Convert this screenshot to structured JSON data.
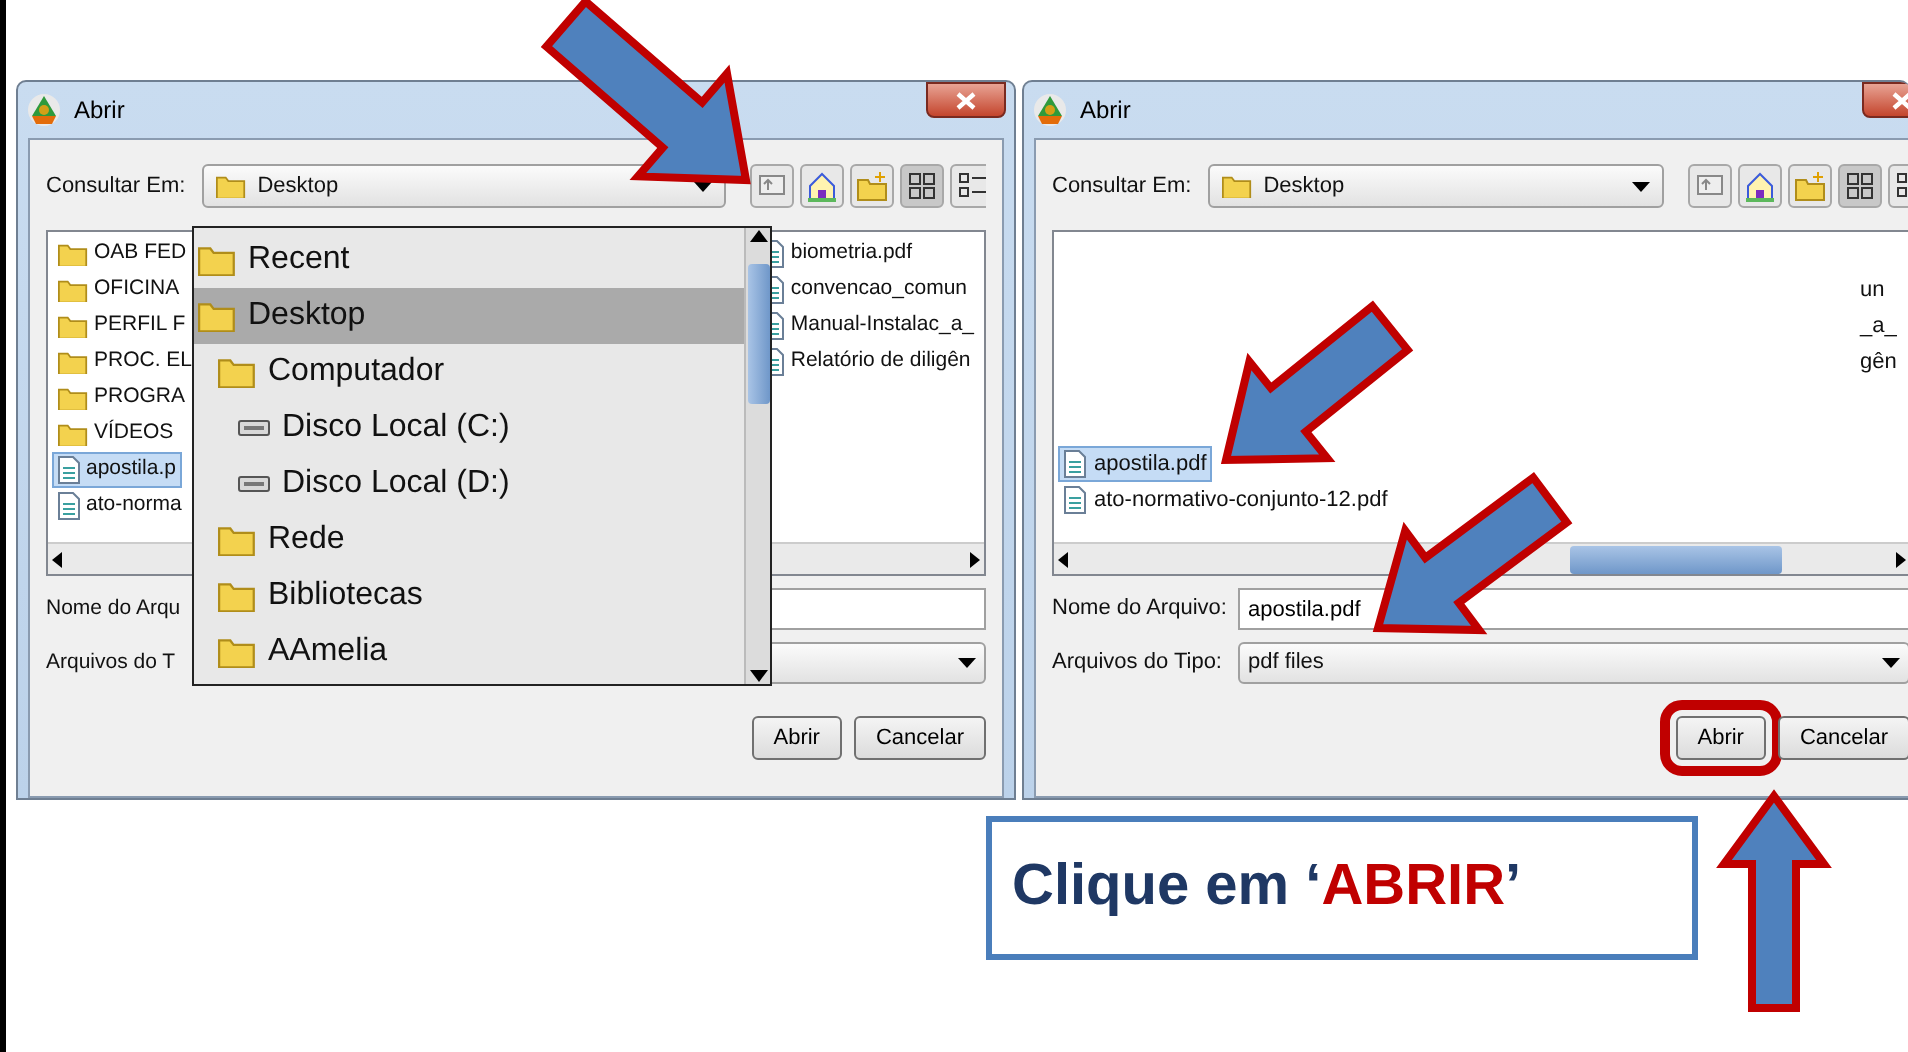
{
  "dialogs": [
    {
      "title": "Abrir",
      "look_in_label": "Consultar Em:",
      "look_in": "Desktop",
      "file_columns": [
        [
          {
            "name": "OAB FED",
            "kind": "folder",
            "selected": false
          },
          {
            "name": "OFICINA",
            "kind": "folder",
            "selected": false
          },
          {
            "name": "PERFIL F",
            "kind": "folder",
            "selected": false
          },
          {
            "name": "PROC. EL",
            "kind": "folder",
            "selected": false
          },
          {
            "name": "PROGRA",
            "kind": "folder",
            "selected": false
          },
          {
            "name": "VÍDEOS",
            "kind": "folder",
            "selected": false
          },
          {
            "name": "apostila.p",
            "kind": "file",
            "selected": true
          },
          {
            "name": "ato-norma",
            "kind": "file",
            "selected": false
          }
        ],
        [
          {
            "name": "biometria.pdf",
            "kind": "file",
            "selected": false
          },
          {
            "name": "convencao_comun",
            "kind": "file",
            "selected": false
          },
          {
            "name": "Manual-Instalac_a_",
            "kind": "file",
            "selected": false
          },
          {
            "name": "Relatório de diligên",
            "kind": "file",
            "selected": false
          }
        ]
      ],
      "file_name_label": "Nome do Arqu",
      "file_type_label": "Arquivos do T",
      "buttons": [
        {
          "label": "Abrir",
          "highlighted": false
        },
        {
          "label": "Cancelar",
          "highlighted": false
        }
      ],
      "dropdown": {
        "items": [
          {
            "label": "Recent",
            "kind": "folder",
            "selected": false
          },
          {
            "label": "Desktop",
            "kind": "folder",
            "selected": true,
            "children": [
              {
                "label": "Computador",
                "kind": "folder",
                "selected": false,
                "children": [
                  {
                    "label": "Disco Local (C:)",
                    "kind": "drive",
                    "selected": false
                  },
                  {
                    "label": "Disco Local (D:)",
                    "kind": "drive",
                    "selected": false
                  }
                ]
              },
              {
                "label": "Rede",
                "kind": "folder",
                "selected": false
              },
              {
                "label": "Bibliotecas",
                "kind": "folder",
                "selected": false
              },
              {
                "label": "AAmelia",
                "kind": "folder",
                "selected": false
              }
            ]
          }
        ]
      }
    },
    {
      "title": "Abrir",
      "look_in_label": "Consultar Em:",
      "look_in": "Desktop",
      "file_columns": [
        [
          {
            "name": "apostila.pdf",
            "kind": "file",
            "selected": true
          },
          {
            "name": "ato-normativo-conjunto-12.pdf",
            "kind": "file",
            "selected": false
          }
        ],
        [
          {
            "name": "un",
            "kind": "text",
            "selected": false
          },
          {
            "name": "_a_",
            "kind": "text",
            "selected": false
          },
          {
            "name": "gên",
            "kind": "text",
            "selected": false
          }
        ]
      ],
      "file_name_label": "Nome do Arquivo:",
      "file_name": "apostila.pdf",
      "file_type_label": "Arquivos do Tipo:",
      "file_type": "pdf files",
      "buttons": [
        {
          "label": "Abrir",
          "highlighted": true
        },
        {
          "label": "Cancelar",
          "highlighted": false
        }
      ]
    }
  ],
  "callout": {
    "before": "Clique em ‘",
    "emphasis": "ABRIR",
    "after": "’"
  }
}
